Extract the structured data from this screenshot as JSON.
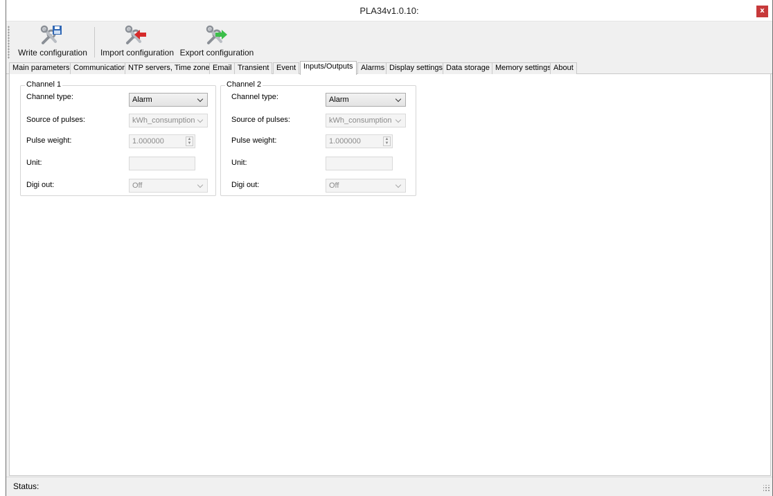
{
  "window": {
    "title": "PLA34v1.0.10:",
    "close_glyph": "x"
  },
  "toolbar": {
    "write_label": "Write configuration",
    "import_label": "Import configuration",
    "export_label": "Export configuration",
    "icons": [
      "tools-save-icon",
      "tools-import-icon",
      "tools-export-icon"
    ]
  },
  "tabs": [
    "Main parameters",
    "Communication",
    "NTP servers, Time zone",
    "Email",
    "Transient",
    "Event",
    "Inputs/Outputs",
    "Alarms",
    "Display settings",
    "Data storage",
    "Memory settings",
    "About"
  ],
  "active_tab": "Inputs/Outputs",
  "labels": {
    "channel_type": "Channel type:",
    "source_of_pulses": "Source of pulses:",
    "pulse_weight": "Pulse weight:",
    "unit": "Unit:",
    "digi_out": "Digi out:"
  },
  "channels": [
    {
      "title": "Channel 1",
      "channel_type": "Alarm",
      "source_of_pulses": "kWh_consumption",
      "pulse_weight": "1.000000",
      "unit": "",
      "digi_out": "Off"
    },
    {
      "title": "Channel 2",
      "channel_type": "Alarm",
      "source_of_pulses": "kWh_consumption",
      "pulse_weight": "1.000000",
      "unit": "",
      "digi_out": "Off"
    }
  ],
  "status": {
    "label": "Status:"
  },
  "colors": {
    "close": "#c7393a",
    "import_arrow": "#d62b2b",
    "export_arrow": "#3cbf4a"
  }
}
